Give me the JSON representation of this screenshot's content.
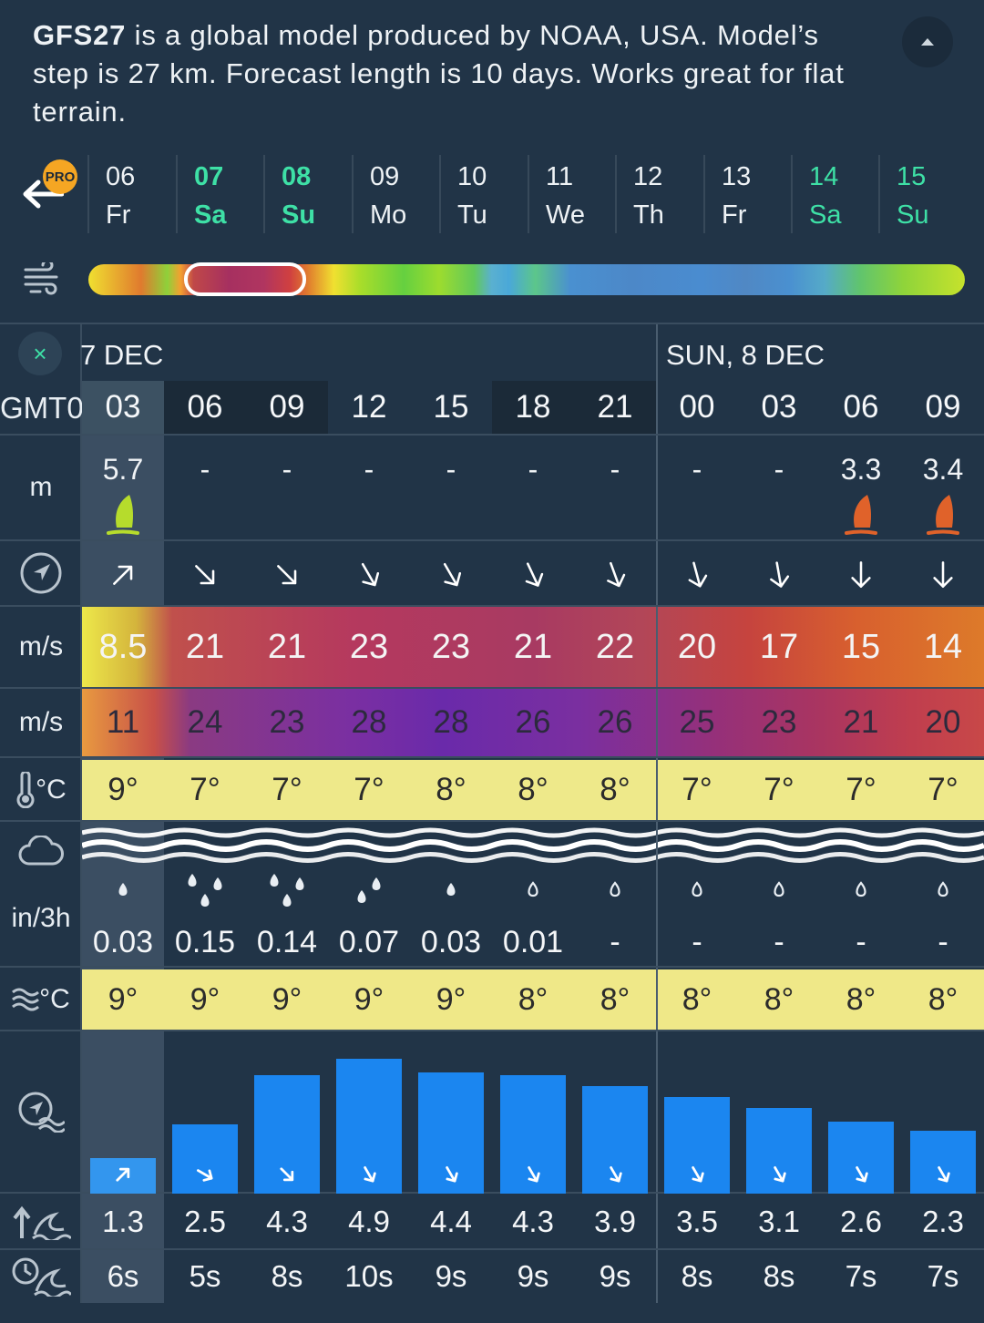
{
  "header": {
    "model_name": "GFS27",
    "description": " is a global model produced by NOAA, USA. Model’s step is 27 km. Forecast length is 10 days. Works great for flat terrain."
  },
  "pro_badge": "PRO",
  "days": [
    {
      "num": "06",
      "wd": "Fr",
      "weekend": false,
      "bold": false
    },
    {
      "num": "07",
      "wd": "Sa",
      "weekend": true,
      "bold": true
    },
    {
      "num": "08",
      "wd": "Su",
      "weekend": true,
      "bold": true
    },
    {
      "num": "09",
      "wd": "Mo",
      "weekend": false,
      "bold": false
    },
    {
      "num": "10",
      "wd": "Tu",
      "weekend": false,
      "bold": false
    },
    {
      "num": "11",
      "wd": "We",
      "weekend": false,
      "bold": false
    },
    {
      "num": "12",
      "wd": "Th",
      "weekend": false,
      "bold": false
    },
    {
      "num": "13",
      "wd": "Fr",
      "weekend": false,
      "bold": false
    },
    {
      "num": "14",
      "wd": "Sa",
      "weekend": true,
      "bold": false
    },
    {
      "num": "15",
      "wd": "Su",
      "weekend": true,
      "bold": false
    }
  ],
  "table": {
    "date_left": "7 DEC",
    "date_right": "SUN, 8 DEC",
    "timezone": "GMT0",
    "units": {
      "wave_height": "m",
      "wind_speed": "m/s",
      "gust": "m/s",
      "temp": "°C",
      "precip": "in/3h",
      "sea_temp": "°C"
    },
    "close_symbol": "×",
    "hours": [
      "03",
      "06",
      "09",
      "12",
      "15",
      "18",
      "21",
      "00",
      "03",
      "06",
      "09"
    ],
    "wave_m": [
      "5.7",
      "-",
      "-",
      "-",
      "-",
      "-",
      "-",
      "-",
      "-",
      "3.3",
      "3.4"
    ],
    "sail": [
      "green",
      "",
      "",
      "",
      "",
      "",
      "",
      "",
      "",
      "orange",
      "orange"
    ],
    "wind_dir_deg": [
      45,
      135,
      135,
      150,
      150,
      155,
      160,
      165,
      170,
      180,
      180
    ],
    "wind_speed": [
      "8.5",
      "21",
      "21",
      "23",
      "23",
      "21",
      "22",
      "20",
      "17",
      "15",
      "14"
    ],
    "gust": [
      "11",
      "24",
      "23",
      "28",
      "28",
      "26",
      "26",
      "25",
      "23",
      "21",
      "20"
    ],
    "temp": [
      "9°",
      "7°",
      "7°",
      "7°",
      "8°",
      "8°",
      "8°",
      "7°",
      "7°",
      "7°",
      "7°"
    ],
    "precip_drops": [
      1,
      3,
      3,
      2,
      1,
      0,
      0,
      0,
      0,
      0,
      0
    ],
    "precip": [
      "0.03",
      "0.15",
      "0.14",
      "0.07",
      "0.03",
      "0.01",
      "-",
      "-",
      "-",
      "-",
      "-"
    ],
    "sea_temp": [
      "9°",
      "9°",
      "9°",
      "9°",
      "9°",
      "8°",
      "8°",
      "8°",
      "8°",
      "8°",
      "8°"
    ],
    "wave_height": [
      1.3,
      2.5,
      4.3,
      4.9,
      4.4,
      4.3,
      3.9,
      3.5,
      3.1,
      2.6,
      2.3
    ],
    "wave_height_labels": [
      "1.3",
      "2.5",
      "4.3",
      "4.9",
      "4.4",
      "4.3",
      "3.9",
      "3.5",
      "3.1",
      "2.6",
      "2.3"
    ],
    "wave_period": [
      "6s",
      "5s",
      "8s",
      "10s",
      "9s",
      "9s",
      "9s",
      "8s",
      "8s",
      "7s",
      "7s"
    ],
    "wave_dir_deg": [
      45,
      120,
      135,
      150,
      150,
      150,
      150,
      150,
      150,
      150,
      150
    ]
  },
  "colors": {
    "weekend": "#3ee0a6",
    "background": "#213447",
    "wave_bar": "#1b86f0"
  }
}
